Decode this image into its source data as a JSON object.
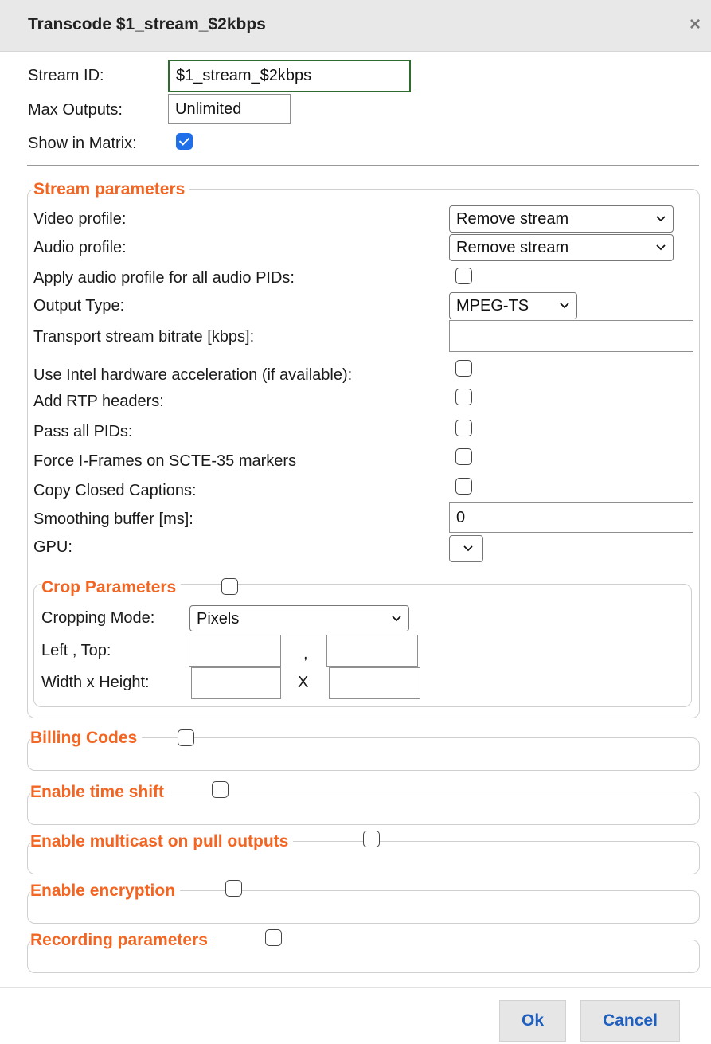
{
  "dialog": {
    "title": "Transcode $1_stream_$2kbps",
    "close_icon": "×"
  },
  "general": {
    "stream_id_label": "Stream ID:",
    "stream_id_value": "$1_stream_$2kbps",
    "max_outputs_label": "Max Outputs:",
    "max_outputs_value": "Unlimited",
    "show_in_matrix_label": "Show in Matrix:",
    "show_in_matrix_checked": true
  },
  "stream_params": {
    "legend": "Stream parameters",
    "video_profile_label": "Video profile:",
    "video_profile_value": "Remove stream",
    "audio_profile_label": "Audio profile:",
    "audio_profile_value": "Remove stream",
    "apply_audio_label": "Apply audio profile for all audio PIDs:",
    "output_type_label": "Output Type:",
    "output_type_value": "MPEG-TS",
    "ts_bitrate_label": "Transport stream bitrate [kbps]:",
    "ts_bitrate_value": "",
    "intel_label": "Use Intel hardware acceleration (if available):",
    "rtp_label": "Add RTP headers:",
    "pass_pids_label": "Pass all PIDs:",
    "force_iframes_label": "Force I-Frames on SCTE-35 markers",
    "copy_cc_label": "Copy Closed Captions:",
    "smoothing_label": "Smoothing buffer [ms]:",
    "smoothing_value": "0",
    "gpu_label": "GPU:",
    "gpu_value": ""
  },
  "crop": {
    "legend": "Crop Parameters",
    "mode_label": "Cropping Mode:",
    "mode_value": "Pixels",
    "left_top_label": "Left , Top:",
    "comma": ",",
    "width_height_label": "Width x Height:",
    "x_sep": "X"
  },
  "sections": {
    "billing": "Billing Codes",
    "time_shift": "Enable time shift",
    "multicast": "Enable multicast on pull outputs",
    "encryption": "Enable encryption",
    "recording": "Recording parameters"
  },
  "buttons": {
    "ok": "Ok",
    "cancel": "Cancel"
  },
  "colors": {
    "accent_orange": "#f26522",
    "button_text": "#1f5fbf",
    "checkbox_blue": "#1f6feb"
  }
}
